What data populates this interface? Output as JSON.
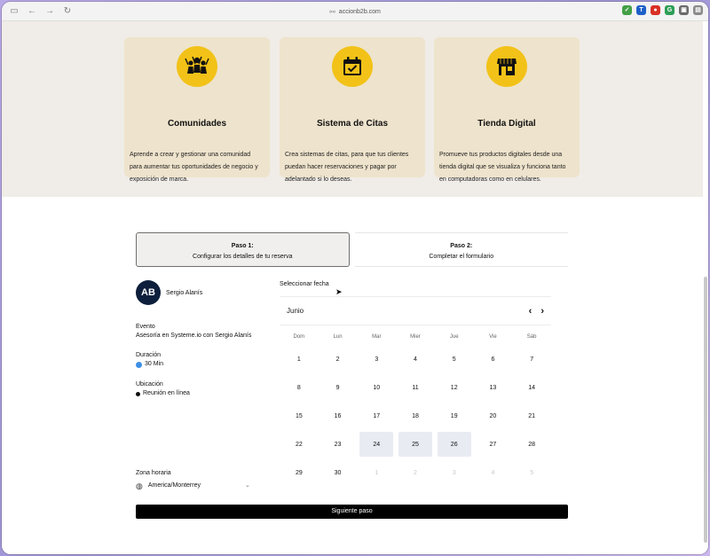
{
  "browser": {
    "url": "accionb2b.com",
    "extensions": [
      {
        "name": "shield-extension",
        "color": "#43a047",
        "glyph": "✓"
      },
      {
        "name": "board-extension",
        "color": "#1e60c8",
        "glyph": "T"
      },
      {
        "name": "record-extension",
        "color": "#d93025",
        "glyph": "●"
      },
      {
        "name": "grammar-extension",
        "color": "#2e9e57",
        "glyph": "G"
      },
      {
        "name": "toolbox-extension",
        "color": "#6b6b6b",
        "glyph": "▣"
      },
      {
        "name": "page-extension",
        "color": "#8a8a8a",
        "glyph": "▤"
      }
    ]
  },
  "features": [
    {
      "title": "Comunidades",
      "icon": "community-icon",
      "description": "Aprende a crear y gestionar una comunidad para aumentar tus oportunidades de negocio y exposición de marca."
    },
    {
      "title": "Sistema de Citas",
      "icon": "calendar-icon",
      "description": "Crea sistemas de citas, para que tus clientes puedan hacer reservaciones y pagar por adelantado si lo deseas."
    },
    {
      "title": "Tienda Digital",
      "icon": "store-icon",
      "description": "Promueve tus productos digitales desde una tienda digital que se visualiza y funciona tanto en computadoras como en celulares."
    }
  ],
  "booking": {
    "steps": [
      {
        "title": "Paso 1:",
        "subtitle": "Configurar los detalles de tu reserva",
        "active": true
      },
      {
        "title": "Paso 2:",
        "subtitle": "Completar el formulario",
        "active": false
      }
    ],
    "host": {
      "name": "Sergio Alanís",
      "avatar_text": "AB"
    },
    "event": {
      "label": "Evento",
      "value": "Asesoría en Systeme.io con Sergio Alanís"
    },
    "duration": {
      "label": "Duración",
      "value": "30 Min"
    },
    "location": {
      "label": "Ubicación",
      "value": "Reunión en línea"
    },
    "timezone": {
      "label": "Zona horaria",
      "value": "America/Monterrey"
    },
    "select_date_label": "Seleccionar fecha",
    "calendar": {
      "month": "Junio",
      "weekdays": [
        "Dom",
        "Lun",
        "Mar",
        "Mier",
        "Jue",
        "Vie",
        "Sáb"
      ],
      "days": [
        {
          "n": "1",
          "state": "normal"
        },
        {
          "n": "2",
          "state": "normal"
        },
        {
          "n": "3",
          "state": "normal"
        },
        {
          "n": "4",
          "state": "normal"
        },
        {
          "n": "5",
          "state": "normal"
        },
        {
          "n": "6",
          "state": "normal"
        },
        {
          "n": "7",
          "state": "normal"
        },
        {
          "n": "8",
          "state": "normal"
        },
        {
          "n": "9",
          "state": "normal"
        },
        {
          "n": "10",
          "state": "normal"
        },
        {
          "n": "11",
          "state": "normal"
        },
        {
          "n": "12",
          "state": "normal"
        },
        {
          "n": "13",
          "state": "normal"
        },
        {
          "n": "14",
          "state": "normal"
        },
        {
          "n": "15",
          "state": "normal"
        },
        {
          "n": "16",
          "state": "normal"
        },
        {
          "n": "17",
          "state": "normal"
        },
        {
          "n": "18",
          "state": "normal"
        },
        {
          "n": "19",
          "state": "normal"
        },
        {
          "n": "20",
          "state": "normal"
        },
        {
          "n": "21",
          "state": "normal"
        },
        {
          "n": "22",
          "state": "normal"
        },
        {
          "n": "23",
          "state": "normal"
        },
        {
          "n": "24",
          "state": "avail"
        },
        {
          "n": "25",
          "state": "avail"
        },
        {
          "n": "26",
          "state": "avail"
        },
        {
          "n": "27",
          "state": "normal"
        },
        {
          "n": "28",
          "state": "normal"
        },
        {
          "n": "29",
          "state": "normal"
        },
        {
          "n": "30",
          "state": "normal"
        },
        {
          "n": "1",
          "state": "muted"
        },
        {
          "n": "2",
          "state": "muted"
        },
        {
          "n": "3",
          "state": "muted"
        },
        {
          "n": "4",
          "state": "muted"
        },
        {
          "n": "5",
          "state": "muted"
        }
      ]
    },
    "next_button": "Siguiente paso"
  },
  "colors": {
    "accent_yellow": "#f2c218",
    "card_bg": "#eee3cc",
    "available_day": "#e8ebf2"
  }
}
